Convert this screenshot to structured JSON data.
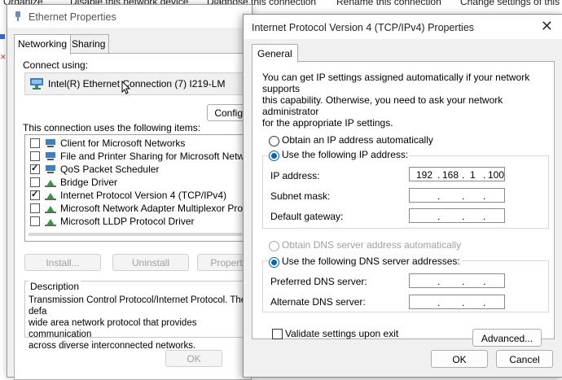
{
  "background": {
    "commands": [
      "Organize",
      "Disable this network device",
      "Diagnose this connection",
      "Rename this connection",
      "Change settings of this c"
    ]
  },
  "ethernet_dialog": {
    "title": "Ethernet Properties",
    "tabs": [
      "Networking",
      "Sharing"
    ],
    "connect_using_label": "Connect using:",
    "adapter_name": "Intel(R) Ethernet Connection (7) I219-LM",
    "configure_button": "Configu",
    "items_label": "This connection uses the following items:",
    "items": [
      {
        "label": "Client for Microsoft Networks",
        "checked": false
      },
      {
        "label": "File and Printer Sharing for Microsoft Networks",
        "checked": false
      },
      {
        "label": "QoS Packet Scheduler",
        "checked": true
      },
      {
        "label": "Bridge Driver",
        "checked": false
      },
      {
        "label": "Internet Protocol Version 4 (TCP/IPv4)",
        "checked": true
      },
      {
        "label": "Microsoft Network Adapter Multiplexor Protocol",
        "checked": false
      },
      {
        "label": "Microsoft LLDP Protocol Driver",
        "checked": false
      }
    ],
    "install_button": "Install...",
    "uninstall_button": "Uninstall",
    "properties_button": "Propert",
    "description_label": "Description",
    "description_lines": [
      "Transmission Control Protocol/Internet Protocol. The defa",
      "wide area network protocol that provides communication",
      "across diverse interconnected networks."
    ],
    "ok_button": "OK"
  },
  "ipv4_dialog": {
    "title": "Internet Protocol Version 4 (TCP/IPv4) Properties",
    "close_glyph": "✕",
    "tab_general": "General",
    "intro_lines": [
      "You can get IP settings assigned automatically if your network supports",
      "this capability. Otherwise, you need to ask your network administrator",
      "for the appropriate IP settings."
    ],
    "obtain_ip_auto": "Obtain an IP address automatically",
    "use_following_ip": "Use the following IP address:",
    "ip_address_label": "IP address:",
    "ip_address": [
      "192",
      "168",
      "1",
      "100"
    ],
    "subnet_mask_label": "Subnet mask:",
    "default_gateway_label": "Default gateway:",
    "obtain_dns_auto": "Obtain DNS server address automatically",
    "use_following_dns": "Use the following DNS server addresses:",
    "preferred_dns_label": "Preferred DNS server:",
    "alternate_dns_label": "Alternate DNS server:",
    "validate_label": "Validate settings upon exit",
    "advanced_button": "Advanced...",
    "ok_button": "OK",
    "cancel_button": "Cancel",
    "ip_selected": "use_following_ip",
    "dns_selected": "use_following_dns"
  },
  "colors": {
    "accent": "#0067c0",
    "dialog_bg": "#f0f0f0"
  }
}
